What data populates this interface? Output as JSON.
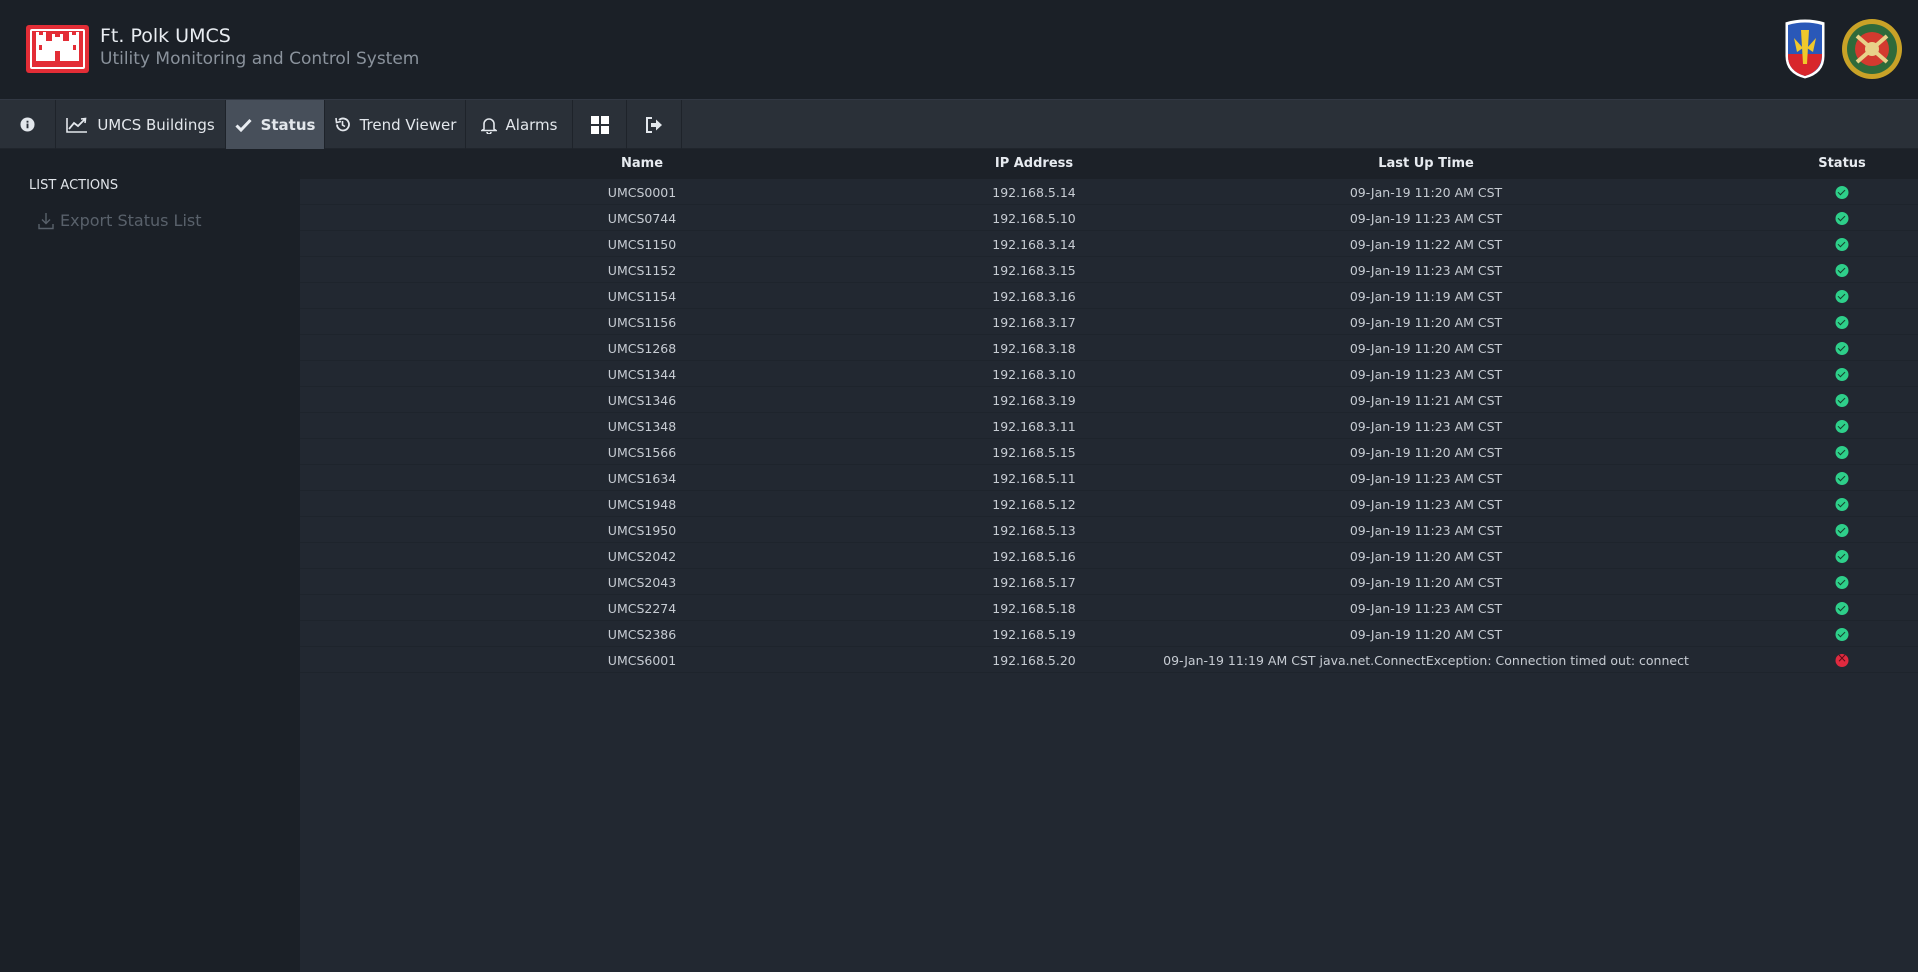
{
  "header": {
    "title": "Ft. Polk UMCS",
    "subtitle": "Utility Monitoring and Control System",
    "logo_icon": "usace-castle-logo",
    "insignia": [
      "jrtc-patch-icon",
      "fort-polk-seal-icon"
    ]
  },
  "nav": {
    "info_icon": "info-icon",
    "buildings": "UMCS Buildings",
    "status": "Status",
    "trend": "Trend Viewer",
    "alarms": "Alarms",
    "grid_icon": "grid-icon",
    "logout_icon": "logout-icon",
    "active_item": "Status"
  },
  "sidebar": {
    "heading": "LIST ACTIONS",
    "export_label": "Export Status List"
  },
  "table": {
    "headers": [
      "Name",
      "IP Address",
      "Last Up Time",
      "Status"
    ],
    "rows": [
      {
        "name": "UMCS0001",
        "ip": "192.168.5.14",
        "time": "09-Jan-19 11:20 AM CST",
        "status": "ok"
      },
      {
        "name": "UMCS0744",
        "ip": "192.168.5.10",
        "time": "09-Jan-19 11:23 AM CST",
        "status": "ok"
      },
      {
        "name": "UMCS1150",
        "ip": "192.168.3.14",
        "time": "09-Jan-19 11:22 AM CST",
        "status": "ok"
      },
      {
        "name": "UMCS1152",
        "ip": "192.168.3.15",
        "time": "09-Jan-19 11:23 AM CST",
        "status": "ok"
      },
      {
        "name": "UMCS1154",
        "ip": "192.168.3.16",
        "time": "09-Jan-19 11:19 AM CST",
        "status": "ok"
      },
      {
        "name": "UMCS1156",
        "ip": "192.168.3.17",
        "time": "09-Jan-19 11:20 AM CST",
        "status": "ok"
      },
      {
        "name": "UMCS1268",
        "ip": "192.168.3.18",
        "time": "09-Jan-19 11:20 AM CST",
        "status": "ok"
      },
      {
        "name": "UMCS1344",
        "ip": "192.168.3.10",
        "time": "09-Jan-19 11:23 AM CST",
        "status": "ok"
      },
      {
        "name": "UMCS1346",
        "ip": "192.168.3.19",
        "time": "09-Jan-19 11:21 AM CST",
        "status": "ok"
      },
      {
        "name": "UMCS1348",
        "ip": "192.168.3.11",
        "time": "09-Jan-19 11:23 AM CST",
        "status": "ok"
      },
      {
        "name": "UMCS1566",
        "ip": "192.168.5.15",
        "time": "09-Jan-19 11:20 AM CST",
        "status": "ok"
      },
      {
        "name": "UMCS1634",
        "ip": "192.168.5.11",
        "time": "09-Jan-19 11:23 AM CST",
        "status": "ok"
      },
      {
        "name": "UMCS1948",
        "ip": "192.168.5.12",
        "time": "09-Jan-19 11:23 AM CST",
        "status": "ok"
      },
      {
        "name": "UMCS1950",
        "ip": "192.168.5.13",
        "time": "09-Jan-19 11:23 AM CST",
        "status": "ok"
      },
      {
        "name": "UMCS2042",
        "ip": "192.168.5.16",
        "time": "09-Jan-19 11:20 AM CST",
        "status": "ok"
      },
      {
        "name": "UMCS2043",
        "ip": "192.168.5.17",
        "time": "09-Jan-19 11:20 AM CST",
        "status": "ok"
      },
      {
        "name": "UMCS2274",
        "ip": "192.168.5.18",
        "time": "09-Jan-19 11:23 AM CST",
        "status": "ok"
      },
      {
        "name": "UMCS2386",
        "ip": "192.168.5.19",
        "time": "09-Jan-19 11:20 AM CST",
        "status": "ok"
      },
      {
        "name": "UMCS6001",
        "ip": "192.168.5.20",
        "time": "09-Jan-19 11:19 AM CST java.net.ConnectException: Connection timed out: connect",
        "status": "error"
      }
    ]
  },
  "colors": {
    "accent_red": "#e32d36",
    "status_ok": "#2ecf8a",
    "status_error": "#e02a3f"
  }
}
